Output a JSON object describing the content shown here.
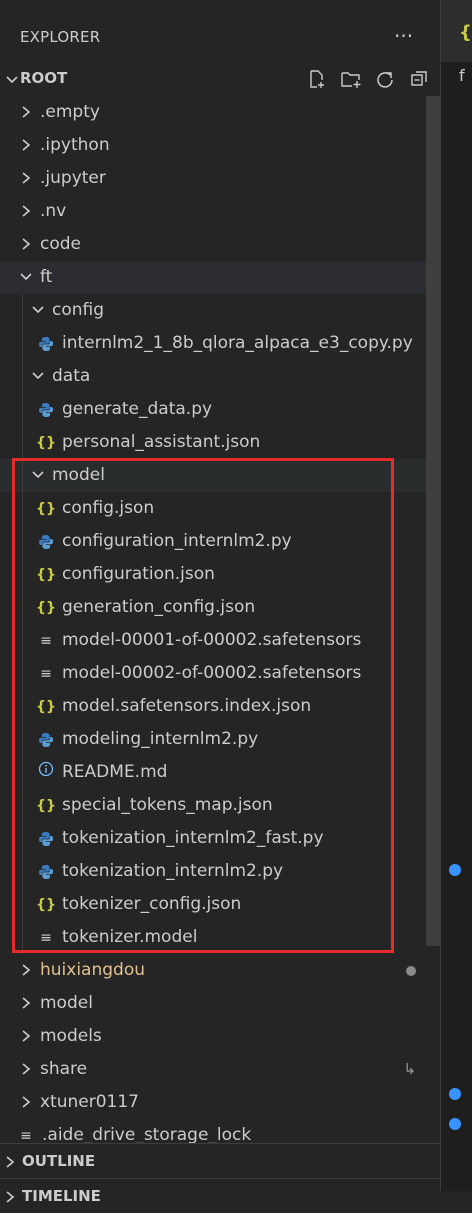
{
  "explorer": {
    "title": "EXPLORER",
    "more_icon": "ellipsis-icon",
    "root_label": "ROOT",
    "root_actions": [
      "new-file-icon",
      "new-folder-icon",
      "refresh-icon",
      "collapse-all-icon"
    ]
  },
  "tree": {
    "empty": ".empty",
    "ipython": ".ipython",
    "jupyter": ".jupyter",
    "nv": ".nv",
    "code": "code",
    "ft": "ft",
    "config": "config",
    "config_file": "internlm2_1_8b_qlora_alpaca_e3_copy.py",
    "data": "data",
    "generate_data": "generate_data.py",
    "personal_assistant": "personal_assistant.json",
    "model": "model",
    "model_files": [
      "config.json",
      "configuration_internlm2.py",
      "configuration.json",
      "generation_config.json",
      "model-00001-of-00002.safetensors",
      "model-00002-of-00002.safetensors",
      "model.safetensors.index.json",
      "modeling_internlm2.py",
      "README.md",
      "special_tokens_map.json",
      "tokenization_internlm2_fast.py",
      "tokenization_internlm2.py",
      "tokenizer_config.json",
      "tokenizer.model"
    ],
    "huixiangdou": "huixiangdou",
    "model_root": "model",
    "models": "models",
    "share": "share",
    "xtuner": "xtuner0117",
    "lock_file": ".aide_drive_storage_lock"
  },
  "sections": {
    "outline": "OUTLINE",
    "timeline": "TIMELINE"
  },
  "editor": {
    "tab_icon": "{",
    "line_text": "f"
  },
  "colors": {
    "sidebar_bg": "#252526",
    "highlight_box": "#e52b2b",
    "json_icon": "#cbcb41",
    "python_icon": "#3776ab",
    "modified_text": "#e2c08d"
  }
}
